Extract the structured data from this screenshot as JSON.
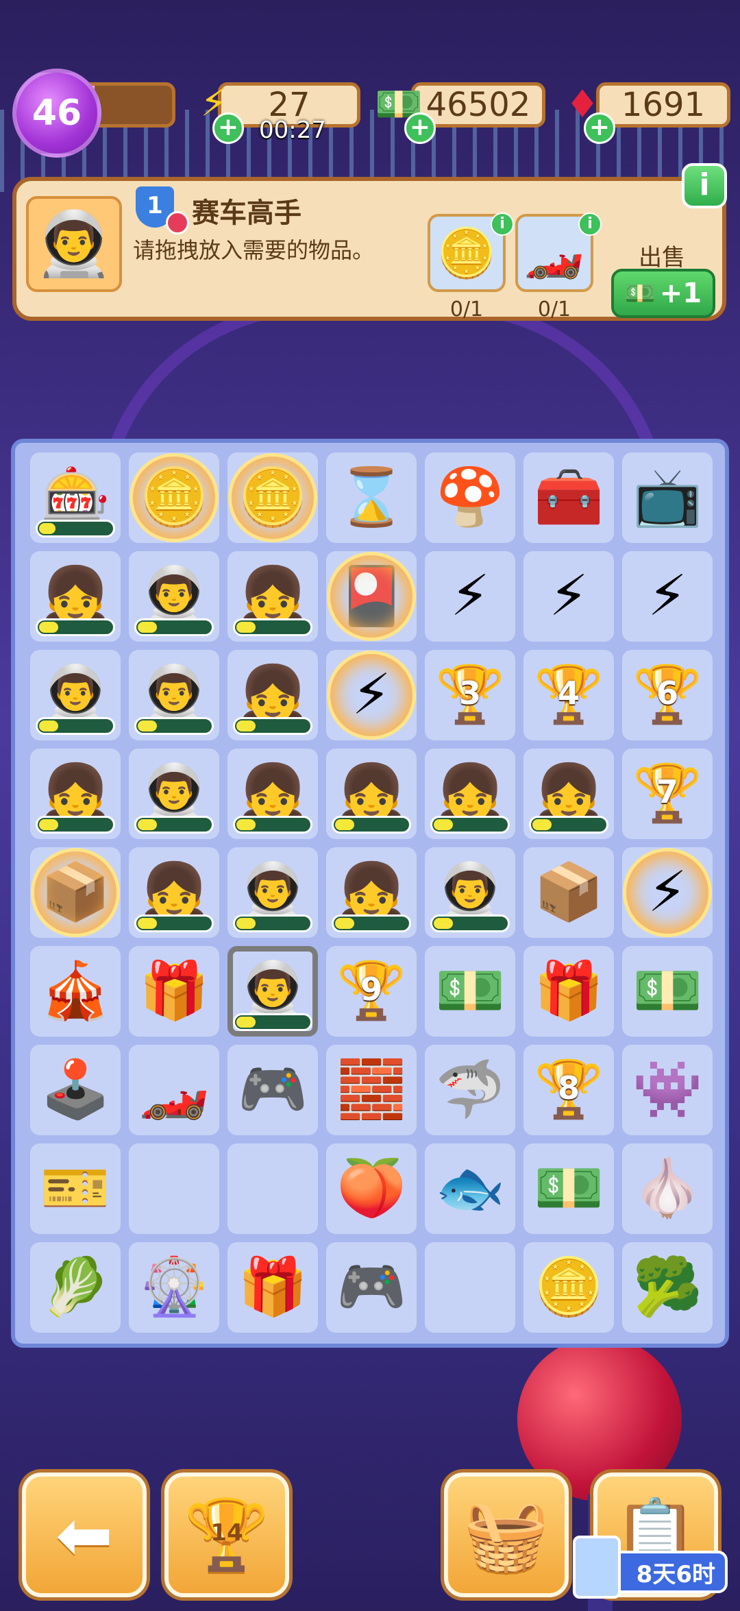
{
  "hud": {
    "level": "46",
    "level_progress": 0.12,
    "energy": "27",
    "energy_timer": "00:27",
    "cash": "46502",
    "gems": "1691"
  },
  "quest": {
    "rank": "1",
    "title": "赛车高手",
    "description": "请拖拽放入需要的物品。",
    "requirements": [
      {
        "name": "coins",
        "count": "0/1"
      },
      {
        "name": "race-car",
        "count": "0/1"
      }
    ],
    "sell_label": "出售",
    "sell_reward": "+1",
    "info": "i"
  },
  "board": {
    "rows": [
      [
        {
          "name": "arcade-cabinet",
          "glyph": "🎰",
          "progress": 0.0
        },
        {
          "name": "coin-stack-glow",
          "glyph": "🪙",
          "glow": true
        },
        {
          "name": "coin-stack-glow",
          "glyph": "🪙",
          "glow": true
        },
        {
          "name": "hourglass-token",
          "glyph": "⌛"
        },
        {
          "name": "mushroom",
          "glyph": "🍄"
        },
        {
          "name": "red-toolbox",
          "glyph": "🧰"
        },
        {
          "name": "retro-tv",
          "glyph": "📺"
        }
      ],
      [
        {
          "name": "gamer-girl",
          "glyph": "👧",
          "progress": 0.25
        },
        {
          "name": "racer",
          "glyph": "👨‍🚀",
          "progress": 0.25
        },
        {
          "name": "gamer-girl",
          "glyph": "👧",
          "progress": 0.25
        },
        {
          "name": "game-card-glow",
          "glyph": "🎴",
          "glow": true
        },
        {
          "name": "energy-orb-blue",
          "glyph": "⚡"
        },
        {
          "name": "energy-orb-orange",
          "glyph": "⚡"
        },
        {
          "name": "energy-orb-red",
          "glyph": "⚡"
        }
      ],
      [
        {
          "name": "racer",
          "glyph": "👨‍🚀",
          "progress": 0.25
        },
        {
          "name": "racer",
          "glyph": "👨‍🚀",
          "progress": 0.25
        },
        {
          "name": "gamer-girl",
          "glyph": "👧",
          "progress": 0.25
        },
        {
          "name": "energy-token-glow",
          "glyph": "⚡",
          "glow": true
        },
        {
          "name": "trophy-gold",
          "glyph": "🏆",
          "label": "3"
        },
        {
          "name": "trophy-silver",
          "glyph": "🏆",
          "label": "4"
        },
        {
          "name": "trophy-silver",
          "glyph": "🏆",
          "label": "6"
        }
      ],
      [
        {
          "name": "gamer-girl",
          "glyph": "👧",
          "progress": 0.25
        },
        {
          "name": "racer",
          "glyph": "👨‍🚀",
          "progress": 0.25
        },
        {
          "name": "gamer-girl",
          "glyph": "👧",
          "progress": 0.25
        },
        {
          "name": "gamer-girl",
          "glyph": "👧",
          "progress": 0.25
        },
        {
          "name": "gamer-girl",
          "glyph": "👧",
          "progress": 0.25
        },
        {
          "name": "gamer-girl",
          "glyph": "👧",
          "progress": 0.25
        },
        {
          "name": "trophy-silver",
          "glyph": "🏆",
          "label": "7"
        }
      ],
      [
        {
          "name": "box-glow",
          "glyph": "📦",
          "glow": true
        },
        {
          "name": "gamer-girl",
          "glyph": "👧",
          "progress": 0.25
        },
        {
          "name": "racer",
          "glyph": "👨‍🚀",
          "progress": 0.25
        },
        {
          "name": "gamer-girl",
          "glyph": "👧",
          "progress": 0.25
        },
        {
          "name": "racer",
          "glyph": "👨‍🚀",
          "progress": 0.25
        },
        {
          "name": "cardboard-boxes",
          "glyph": "📦"
        },
        {
          "name": "energy-token-glow",
          "glyph": "⚡",
          "glow": true
        }
      ],
      [
        {
          "name": "claw-machine-pink",
          "glyph": "🎪"
        },
        {
          "name": "claw-machine-yellow",
          "glyph": "🎁"
        },
        {
          "name": "racer-selected",
          "glyph": "👨‍🚀",
          "progress": 0.25,
          "selected": true
        },
        {
          "name": "trophy-bronze",
          "glyph": "🏆",
          "label": "9"
        },
        {
          "name": "cash-bundle",
          "glyph": "💵"
        },
        {
          "name": "claw-machine-yellow",
          "glyph": "🎁"
        },
        {
          "name": "cash-pile",
          "glyph": "💵"
        }
      ],
      [
        {
          "name": "arcade-machine",
          "glyph": "🕹️"
        },
        {
          "name": "race-arcade",
          "glyph": "🏎️"
        },
        {
          "name": "handheld-console",
          "glyph": "🎮"
        },
        {
          "name": "red-tray",
          "glyph": "🧱"
        },
        {
          "name": "shark",
          "glyph": "🦈"
        },
        {
          "name": "trophy-bronze",
          "glyph": "🏆",
          "label": "8"
        },
        {
          "name": "purple-monster",
          "glyph": "👾"
        }
      ],
      [
        {
          "name": "music-ticket",
          "glyph": "🎫"
        },
        {
          "name": "empty",
          "empty": true
        },
        {
          "name": "empty",
          "empty": true
        },
        {
          "name": "peach",
          "glyph": "🍑"
        },
        {
          "name": "blue-fish",
          "glyph": "🐟"
        },
        {
          "name": "cash-tower",
          "glyph": "💵"
        },
        {
          "name": "garlic",
          "glyph": "🧄"
        }
      ],
      [
        {
          "name": "celery",
          "glyph": "🥬"
        },
        {
          "name": "prize-wheel",
          "glyph": "🎡"
        },
        {
          "name": "mystery-box",
          "glyph": "🎁"
        },
        {
          "name": "game-console-ghost",
          "glyph": "🎮"
        },
        {
          "name": "empty",
          "empty": true
        },
        {
          "name": "coins",
          "glyph": "🪙"
        },
        {
          "name": "broccoli",
          "glyph": "🥦"
        }
      ]
    ]
  },
  "nav": {
    "trophy_count": "14",
    "event_timer": "8天6时"
  }
}
